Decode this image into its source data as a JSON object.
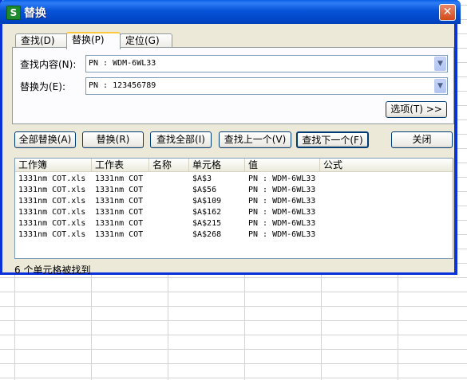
{
  "title": "替换",
  "app_icon_letter": "S",
  "close_glyph": "✕",
  "tabs": [
    {
      "label": "查找(D)"
    },
    {
      "label": "替换(P)"
    },
    {
      "label": "定位(G)"
    }
  ],
  "find": {
    "label": "查找内容(N):",
    "value": "PN : WDM-6WL33"
  },
  "replace": {
    "label": "替换为(E):",
    "value": "PN : 123456789"
  },
  "options_button": "选项(T) >>",
  "buttons": {
    "replace_all": "全部替换(A)",
    "replace": "替换(R)",
    "find_all": "查找全部(I)",
    "find_prev": "查找上一个(V)",
    "find_next": "查找下一个(F)",
    "close": "关闭"
  },
  "dropdown_glyph": "▼",
  "results": {
    "columns": [
      "工作簿",
      "工作表",
      "名称",
      "单元格",
      "值",
      "公式"
    ],
    "rows": [
      {
        "workbook": "1331nm COT.xls",
        "sheet": "1331nm COT",
        "name": "",
        "cell": "$A$3",
        "value": "PN : WDM-6WL33",
        "formula": ""
      },
      {
        "workbook": "1331nm COT.xls",
        "sheet": "1331nm COT",
        "name": "",
        "cell": "$A$56",
        "value": "PN : WDM-6WL33",
        "formula": ""
      },
      {
        "workbook": "1331nm COT.xls",
        "sheet": "1331nm COT",
        "name": "",
        "cell": "$A$109",
        "value": "PN : WDM-6WL33",
        "formula": ""
      },
      {
        "workbook": "1331nm COT.xls",
        "sheet": "1331nm COT",
        "name": "",
        "cell": "$A$162",
        "value": "PN : WDM-6WL33",
        "formula": ""
      },
      {
        "workbook": "1331nm COT.xls",
        "sheet": "1331nm COT",
        "name": "",
        "cell": "$A$215",
        "value": "PN : WDM-6WL33",
        "formula": ""
      },
      {
        "workbook": "1331nm COT.xls",
        "sheet": "1331nm COT",
        "name": "",
        "cell": "$A$268",
        "value": "PN : WDM-6WL33",
        "formula": ""
      }
    ]
  },
  "status": "6 个单元格被找到",
  "colors": {
    "titlebar": "#0054e3",
    "dialog": "#ece9d8",
    "active_tab_accent": "#ffc83c"
  }
}
